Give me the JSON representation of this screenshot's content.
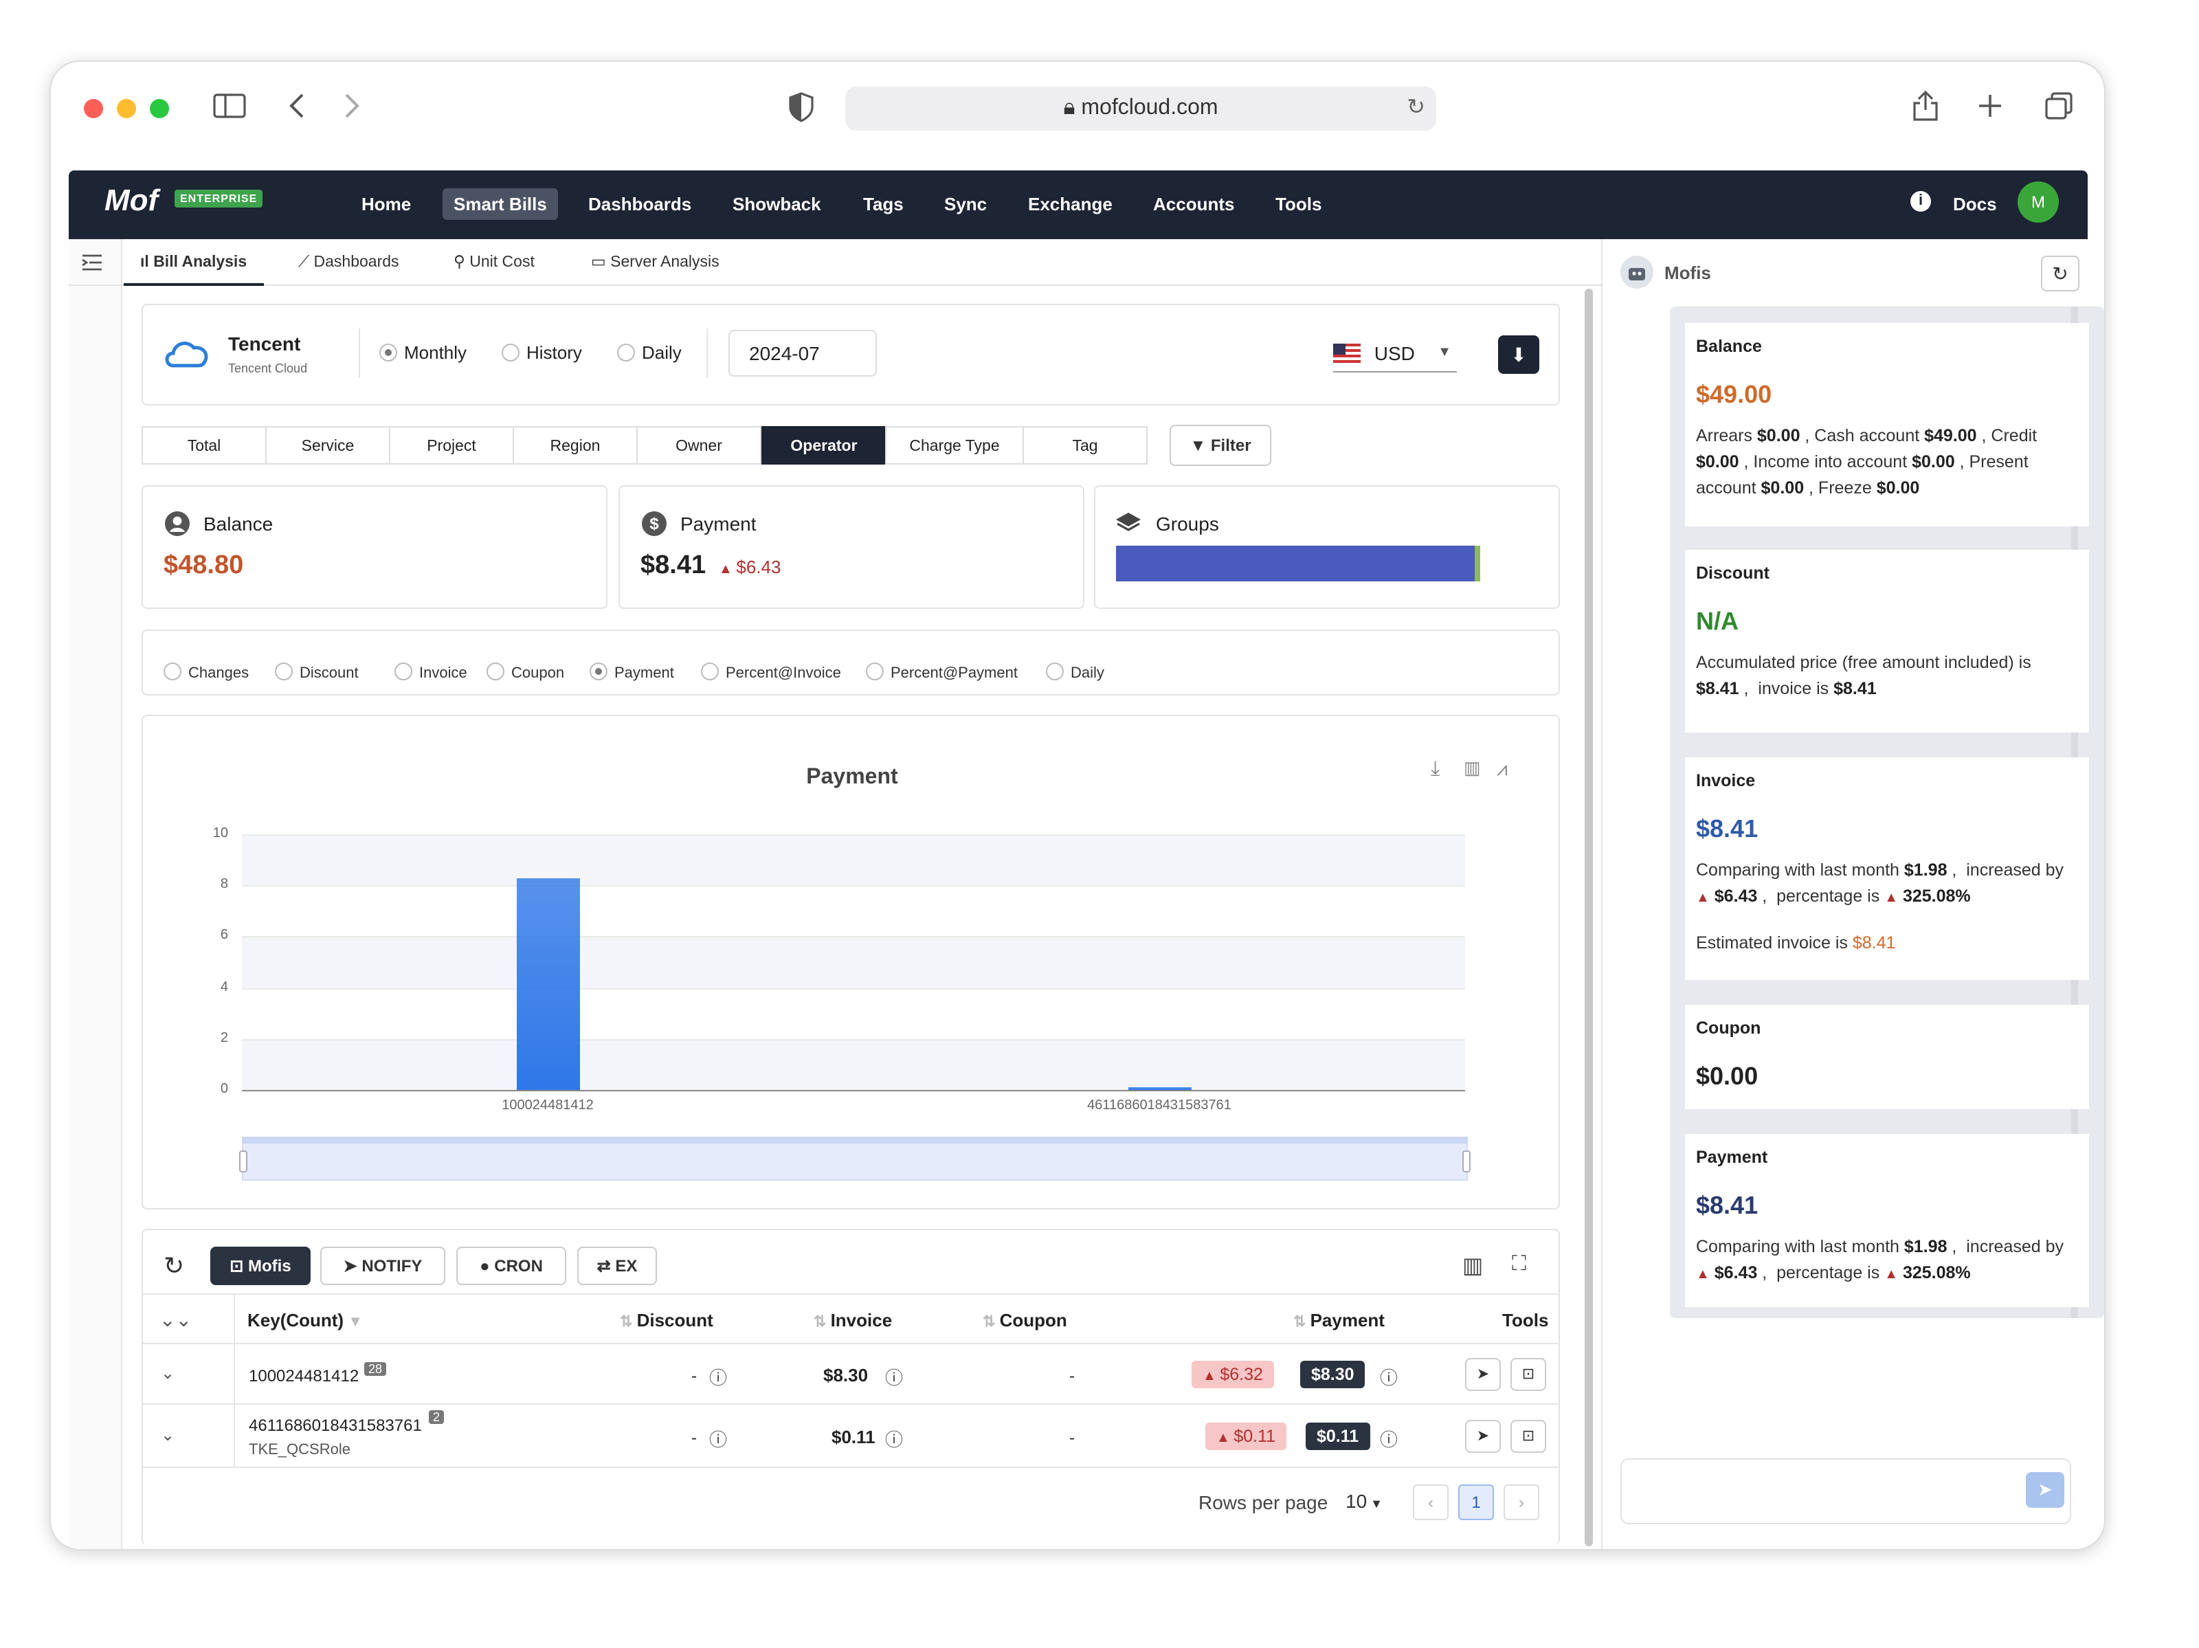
{
  "browser": {
    "url": "mofcloud.com"
  },
  "nav": {
    "logo": "Mof",
    "badge": "ENTERPRISE",
    "items": [
      "Home",
      "Smart Bills",
      "Dashboards",
      "Showback",
      "Tags",
      "Sync",
      "Exchange",
      "Accounts",
      "Tools"
    ],
    "active": "Smart Bills",
    "docs": "Docs",
    "avatar": "M"
  },
  "subtabs": [
    "Bill Analysis",
    "Dashboards",
    "Unit Cost",
    "Server Analysis"
  ],
  "provider": {
    "name": "Tencent",
    "sub": "Tencent Cloud"
  },
  "period": {
    "options": [
      "Monthly",
      "History",
      "Daily"
    ],
    "selected": "Monthly",
    "month": "2024-07"
  },
  "currency": "USD",
  "dimensions": {
    "tabs": [
      "Total",
      "Service",
      "Project",
      "Region",
      "Owner",
      "Operator",
      "Charge Type",
      "Tag"
    ],
    "active": "Operator",
    "filter": "Filter"
  },
  "summary": {
    "balance_label": "Balance",
    "balance": "$48.80",
    "payment_label": "Payment",
    "payment": "$8.41",
    "payment_delta": "$6.43",
    "groups_label": "Groups"
  },
  "metrics": {
    "options": [
      "Changes",
      "Discount",
      "Invoice",
      "Coupon",
      "Payment",
      "Percent@Invoice",
      "Percent@Payment",
      "Daily"
    ],
    "selected": "Payment"
  },
  "chart_data": {
    "type": "bar",
    "title": "Payment",
    "categories": [
      "100024481412",
      "4611686018431583761"
    ],
    "values": [
      8.3,
      0.11
    ],
    "ylim": [
      0,
      10
    ],
    "yticks": [
      "0",
      "2",
      "4",
      "6",
      "8",
      "10"
    ],
    "grid": true,
    "color": "#2f77e8"
  },
  "table": {
    "toolbar": {
      "mofis": "Mofis",
      "notify": "NOTIFY",
      "cron": "CRON",
      "ex": "EX"
    },
    "headers": {
      "key": "Key(Count)",
      "discount": "Discount",
      "invoice": "Invoice",
      "coupon": "Coupon",
      "payment": "Payment",
      "tools": "Tools"
    },
    "rows": [
      {
        "key": "100024481412",
        "count": "28",
        "sub": "",
        "discount": "-",
        "invoice": "$8.30",
        "coupon": "-",
        "delta": "$6.32",
        "payment": "$8.30"
      },
      {
        "key": "4611686018431583761",
        "count": "2",
        "sub": "TKE_QCSRole",
        "discount": "-",
        "invoice": "$0.11",
        "coupon": "-",
        "delta": "$0.11",
        "payment": "$0.11"
      }
    ],
    "rows_per_page_label": "Rows per page",
    "rows_per_page": "10",
    "page": "1"
  },
  "assistant": {
    "name": "Mofis",
    "balance": {
      "title": "Balance",
      "value": "$49.00",
      "arrears": "$0.00",
      "cash": "$49.00",
      "credit": "$0.00",
      "income": "$0.00",
      "present": "$0.00",
      "freeze": "$0.00"
    },
    "discount": {
      "title": "Discount",
      "value": "N/A",
      "accumulated": "$8.41",
      "invoice": "$8.41"
    },
    "invoice": {
      "title": "Invoice",
      "value": "$8.41",
      "last_month": "$1.98",
      "increase": "$6.43",
      "percentage": "325.08%",
      "estimated": "$8.41"
    },
    "coupon": {
      "title": "Coupon",
      "value": "$0.00"
    },
    "payment": {
      "title": "Payment",
      "value": "$8.41",
      "last_month": "$1.98",
      "increase": "$6.43",
      "percentage": "325.08%"
    }
  }
}
